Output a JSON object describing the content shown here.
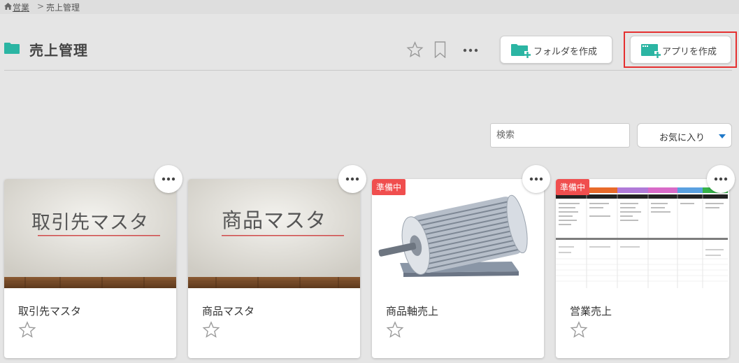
{
  "breadcrumb": {
    "home": "営業",
    "current": "売上管理",
    "separator": ">"
  },
  "page": {
    "title": "売上管理"
  },
  "actions": {
    "create_folder": "フォルダを作成",
    "create_app": "アプリを作成"
  },
  "toolbar": {
    "search_placeholder": "検索",
    "sort_selected": "お気に入り"
  },
  "colors": {
    "accent_teal": "#2bb5a3",
    "highlight_red": "#e53030",
    "badge_red": "#f04e4e",
    "sort_caret": "#1f78c8"
  },
  "cards": [
    {
      "name": "取引先マスタ",
      "thumbnail_text": "取引先マスタ",
      "badge": "",
      "icon": "star-outline-icon"
    },
    {
      "name": "商品マスタ",
      "thumbnail_text": "商品マスタ",
      "badge": "",
      "icon": "star-outline-icon"
    },
    {
      "name": "商品軸売上",
      "thumbnail_text": "",
      "badge": "準備中",
      "icon": "star-outline-icon"
    },
    {
      "name": "営業売上",
      "thumbnail_text": "",
      "badge": "準備中",
      "icon": "star-outline-icon"
    }
  ]
}
